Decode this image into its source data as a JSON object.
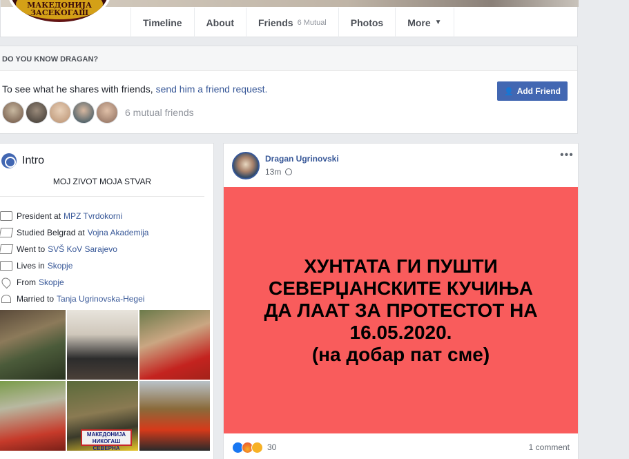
{
  "nav": {
    "tabs": [
      {
        "label": "Timeline"
      },
      {
        "label": "About"
      },
      {
        "label": "Friends",
        "badge": "6 Mutual"
      },
      {
        "label": "Photos"
      },
      {
        "label": "More"
      }
    ]
  },
  "profile_logo": {
    "text": "МАКЕДОНИЈА ЗАСЕКОГАШ"
  },
  "do_you_know": {
    "heading": "DO YOU KNOW DRAGAN?",
    "text": "To see what he shares with friends,",
    "link": "send him a friend request.",
    "button": "Add Friend",
    "mutual_friends": "6 mutual friends"
  },
  "intro": {
    "title": "Intro",
    "bio": "MOJ ZIVOT MOJA STVAR",
    "items": [
      {
        "icon": "briefcase-icon",
        "prefix": "President at",
        "link": "MPZ Tvrdokorni"
      },
      {
        "icon": "graduation-cap-icon",
        "prefix": "Studied Belgrad at",
        "link": "Vojna Akademija"
      },
      {
        "icon": "graduation-cap-icon",
        "prefix": "Went to",
        "link": "SVŠ KoV Sarajevo"
      },
      {
        "icon": "home-icon",
        "prefix": "Lives in",
        "link": "Skopje"
      },
      {
        "icon": "location-pin-icon",
        "prefix": "From",
        "link": "Skopje"
      },
      {
        "icon": "heart-icon",
        "prefix": "Married to",
        "link": "Tanja Ugrinovska-Hegei"
      }
    ],
    "photo_tag": "МАКЕДОНИЈА НИКОГАШ СЕВЕРНА"
  },
  "post": {
    "author": "Dragan Ugrinovski",
    "time": "13m",
    "text_lines": [
      "ХУНТАТА ГИ ПУШТИ",
      "СЕВЕРЏАНСКИТЕ КУЧИЊА",
      "ДА ЛААТ ЗА ПРОТЕСТОТ НА",
      "16.05.2020.",
      "(на добар пат сме)"
    ],
    "bg_color": "#f95c5c",
    "reaction_count": "30",
    "comments": "1 comment"
  }
}
